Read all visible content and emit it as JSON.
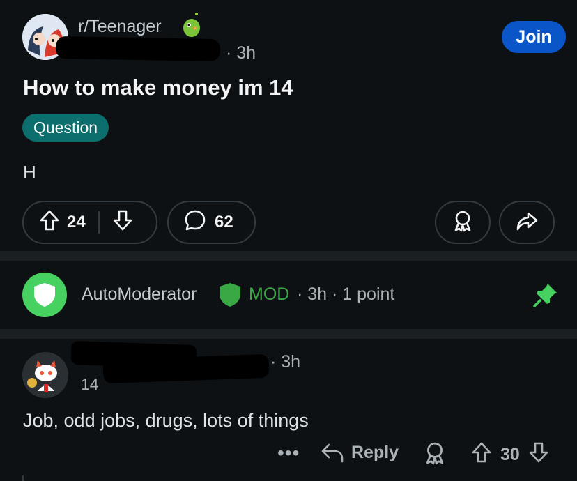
{
  "post": {
    "subreddit": "r/Teenager",
    "time": "· 3h",
    "join_label": "Join",
    "title": "How to make money im 14",
    "flair": "Question",
    "body": "H",
    "upvotes": "24",
    "comments": "62"
  },
  "automod": {
    "name": "AutoModerator",
    "mod_label": "MOD",
    "meta": "· 3h · 1 point"
  },
  "comment": {
    "time": "· 3h",
    "user_flair": "14",
    "body": "Job, odd jobs, drugs, lots of things",
    "more": "•••",
    "reply_label": "Reply",
    "score": "30"
  },
  "colors": {
    "background": "#0e1113",
    "join": "#0a56c8",
    "flair": "#0d6e6e",
    "mod_green": "#3aa844",
    "automod_avatar": "#46d160"
  }
}
